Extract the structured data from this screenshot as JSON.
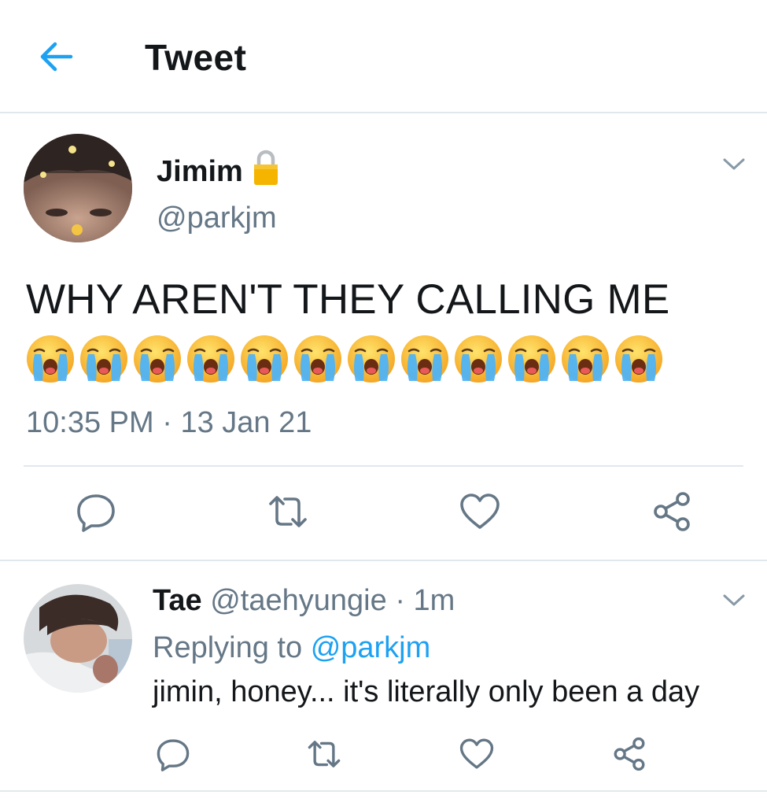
{
  "header": {
    "title": "Tweet",
    "back_icon": "arrow-left-icon"
  },
  "tweet": {
    "author_name": "Jimim",
    "author_handle": "@parkjm",
    "text": "WHY AREN'T THEY CALLING ME",
    "emoji": "😭",
    "emoji_count": 12,
    "time": "10:35 PM",
    "separator": "·",
    "date": "13 Jan 21",
    "actions": [
      "reply-icon",
      "retweet-icon",
      "like-icon",
      "share-icon"
    ]
  },
  "reply": {
    "author_name": "Tae",
    "author_handle": "@taehyungie",
    "separator": "·",
    "age": "1m",
    "replying_label": "Replying to",
    "replying_to": "@parkjm",
    "text": "jimin, honey... it's literally only been a day"
  },
  "colors": {
    "accent": "#1da1f2",
    "secondary_text": "#657786",
    "icon": "#657786",
    "divider": "#e1e8ed",
    "lock": "#f4b400"
  }
}
